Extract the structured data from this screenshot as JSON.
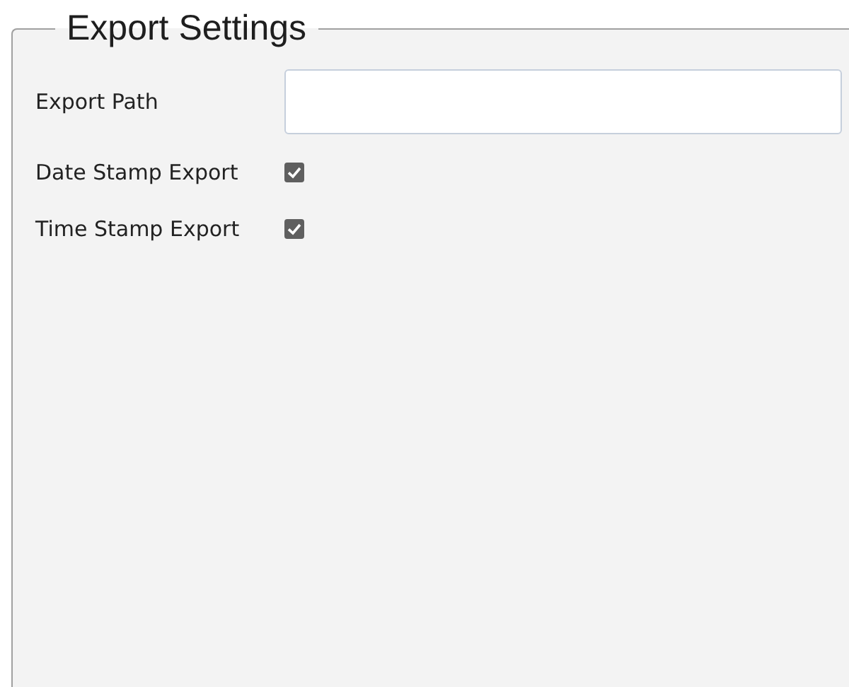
{
  "group": {
    "title": "Export Settings",
    "fields": [
      {
        "kind": "text",
        "label": "Export Path"
      },
      {
        "kind": "checkbox",
        "label": "Date Stamp Export",
        "checked": true
      },
      {
        "kind": "checkbox",
        "label": "Time Stamp Export",
        "checked": true
      }
    ]
  }
}
